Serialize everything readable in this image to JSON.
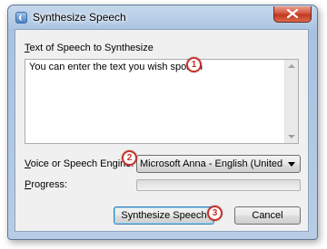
{
  "window": {
    "title": "Synthesize Speech"
  },
  "text_section": {
    "label_accel": "T",
    "label_rest": "ext of Speech to Synthesize",
    "value": "You can enter the text you wish spoken"
  },
  "voice": {
    "label_accel": "V",
    "label_rest": "oice or Speech Engine:",
    "selected": "Microsoft Anna - English (United States)"
  },
  "progress": {
    "label_accel": "P",
    "label_rest": "rogress:",
    "fraction": 0
  },
  "buttons": {
    "synthesize": "Synthesize Speech",
    "cancel": "Cancel"
  },
  "callouts": [
    "1",
    "2",
    "3"
  ],
  "colors": {
    "callout": "#c8312a",
    "titlebar": "#b6cce6",
    "close": "#c0391f"
  }
}
